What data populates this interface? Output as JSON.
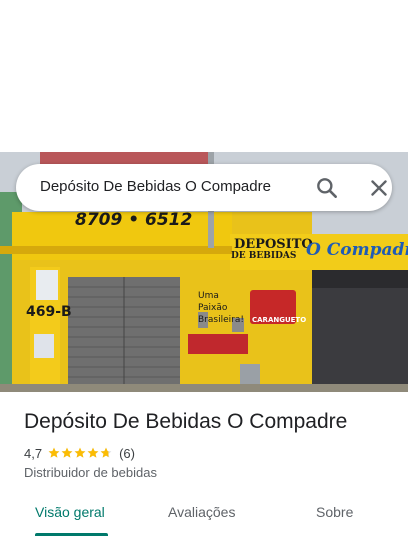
{
  "search": {
    "query": "Depósito De Bebidas O Compadre"
  },
  "photo": {
    "sign_phone": "8709 • 6512",
    "sign_name_top": "DEPOSITO",
    "sign_name_sub": "DE BEBIDAS",
    "sign_name_right": "O Compadre",
    "house_number": "469-B",
    "wall_text": "Uma Paixão Brasileira!",
    "beer_brand": "CARANGUETO"
  },
  "place": {
    "name": "Depósito De Bebidas O Compadre",
    "rating": "4,7",
    "stars_filled": 4.7,
    "review_count": "(6)",
    "category": "Distribuidor de bebidas"
  },
  "tabs": [
    {
      "label": "Visão geral",
      "active": true
    },
    {
      "label": "Avaliações",
      "active": false
    },
    {
      "label": "Sobre",
      "active": false
    }
  ],
  "colors": {
    "accent": "#00796b",
    "star": "#fbbc04",
    "wall_yellow": "#e9c21a"
  }
}
